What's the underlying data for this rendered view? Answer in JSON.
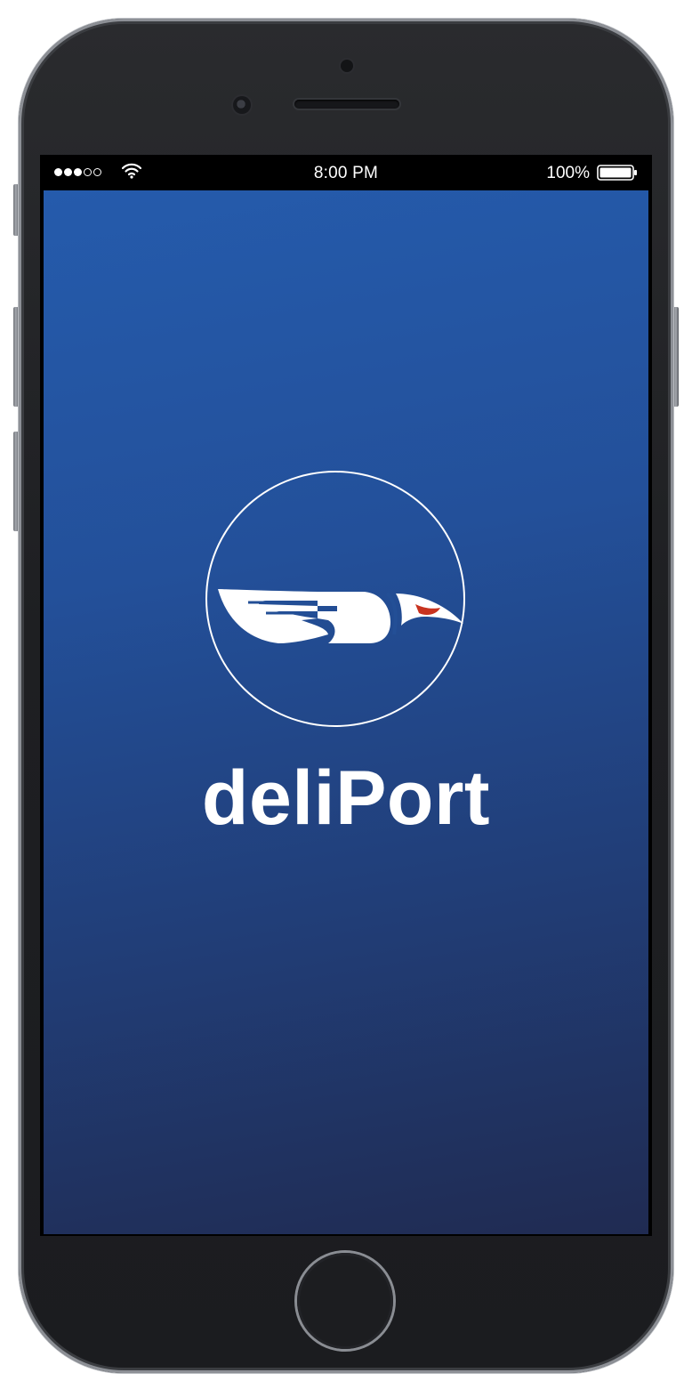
{
  "status_bar": {
    "signal_icon": "signal-dots-icon",
    "signal_bars": [
      1,
      1,
      1,
      0,
      0
    ],
    "wifi_icon": "wifi-icon",
    "time": "8:00 PM",
    "battery_percent": "100%",
    "battery_icon": "battery-icon",
    "battery_level": 1.0
  },
  "splash": {
    "logo_icon": "eagle-head-logo-icon",
    "app_name": "deliPort",
    "background_colors": [
      "#255bac",
      "#202b52"
    ],
    "logo_eye_color": "#c8331f"
  },
  "device": {
    "home_button_icon": "home-button"
  }
}
